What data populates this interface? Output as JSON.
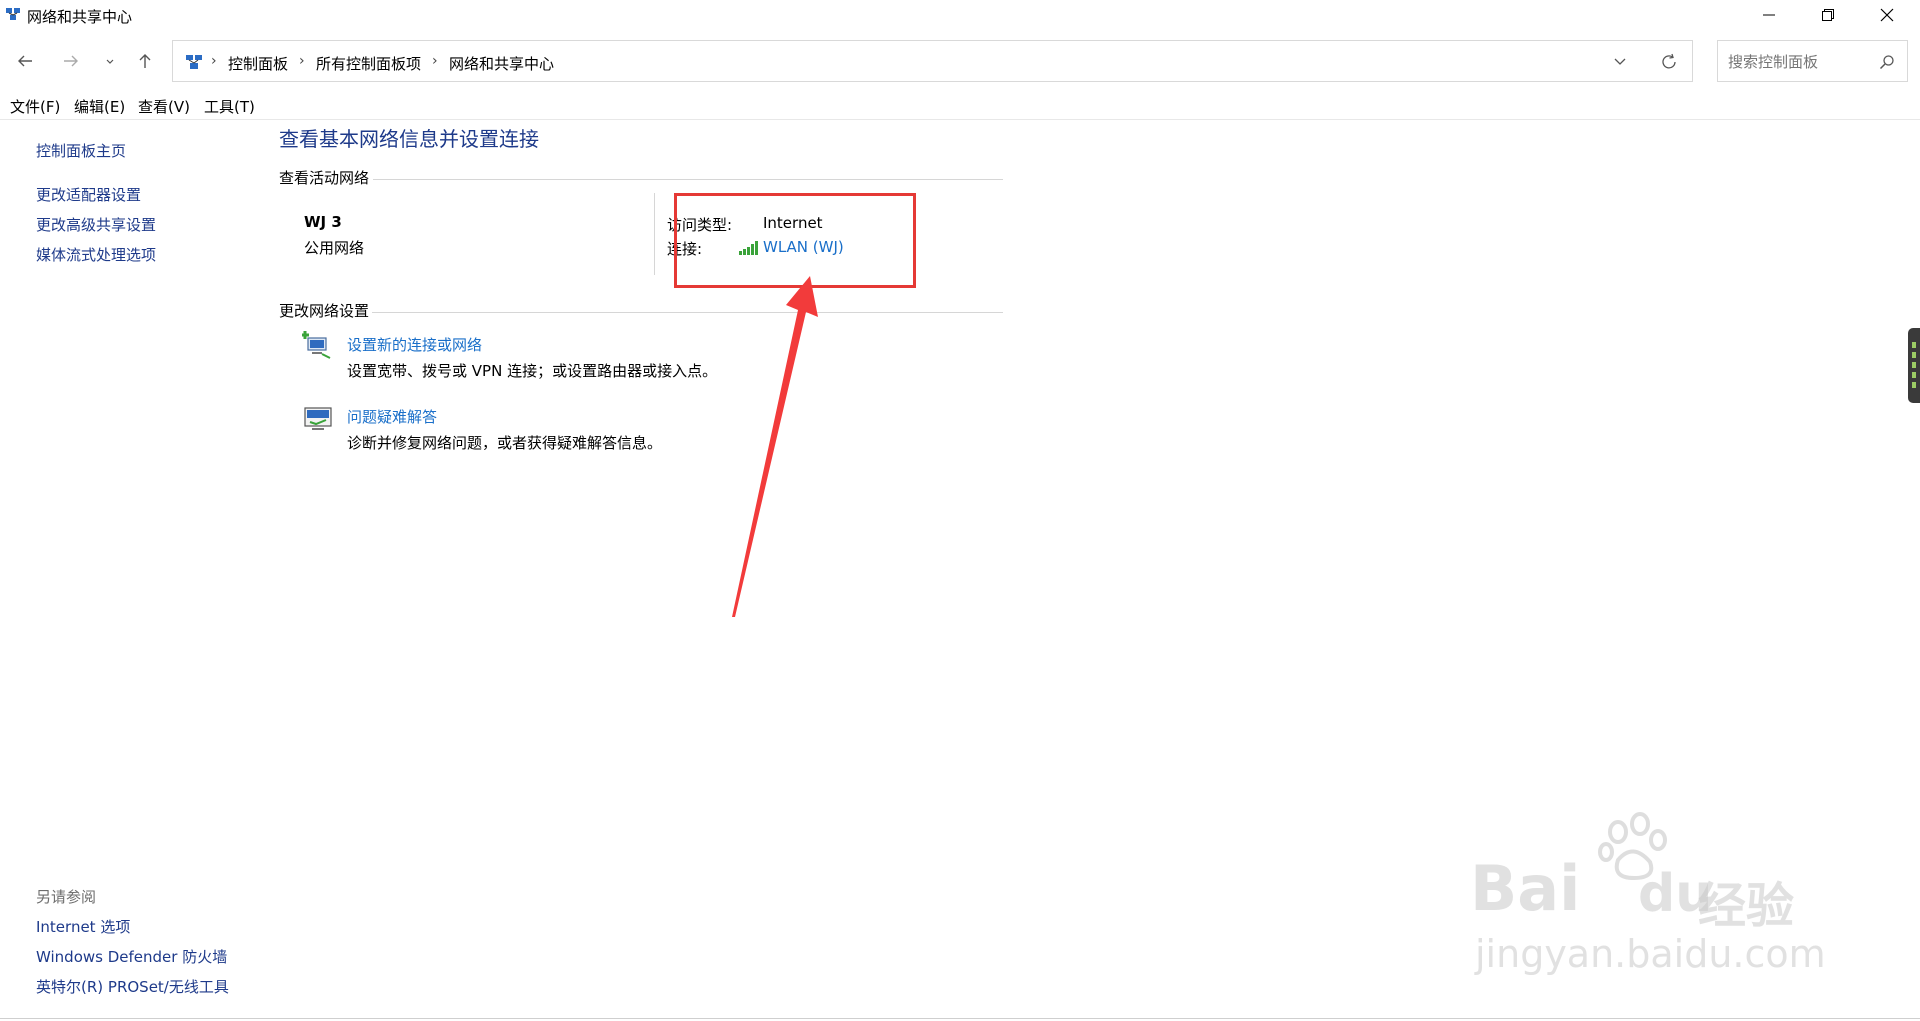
{
  "window": {
    "title": "网络和共享中心",
    "minimize_icon": "minimize-icon",
    "restore_icon": "restore-icon",
    "close_icon": "close-icon"
  },
  "navigation": {
    "breadcrumb": [
      "控制面板",
      "所有控制面板项",
      "网络和共享中心"
    ],
    "search_placeholder": "搜索控制面板"
  },
  "menu": [
    "文件(F)",
    "编辑(E)",
    "查看(V)",
    "工具(T)"
  ],
  "sidebar": {
    "home": "控制面板主页",
    "links": [
      "更改适配器设置",
      "更改高级共享设置",
      "媒体流式处理选项"
    ],
    "see_also_title": "另请参阅",
    "see_also": [
      "Internet 选项",
      "Windows Defender 防火墙",
      "英特尔(R) PROSet/无线工具"
    ]
  },
  "main": {
    "title": "查看基本网络信息并设置连接",
    "active_section": "查看活动网络",
    "network": {
      "name": "WJ 3",
      "type": "公用网络",
      "access_label": "访问类型:",
      "access_value": "Internet",
      "connection_label": "连接:",
      "connection_value": "WLAN (WJ)"
    },
    "change_section": "更改网络设置",
    "tasks": [
      {
        "title": "设置新的连接或网络",
        "desc": "设置宽带、拨号或 VPN 连接；或设置路由器或接入点。"
      },
      {
        "title": "问题疑难解答",
        "desc": "诊断并修复网络问题，或者获得疑难解答信息。"
      }
    ]
  },
  "annotation": {
    "color": "#e53935"
  },
  "watermark": {
    "brand": "Bai",
    "brand2": "du",
    "brand_cn": "经验",
    "url": "jingyan.baidu.com"
  }
}
